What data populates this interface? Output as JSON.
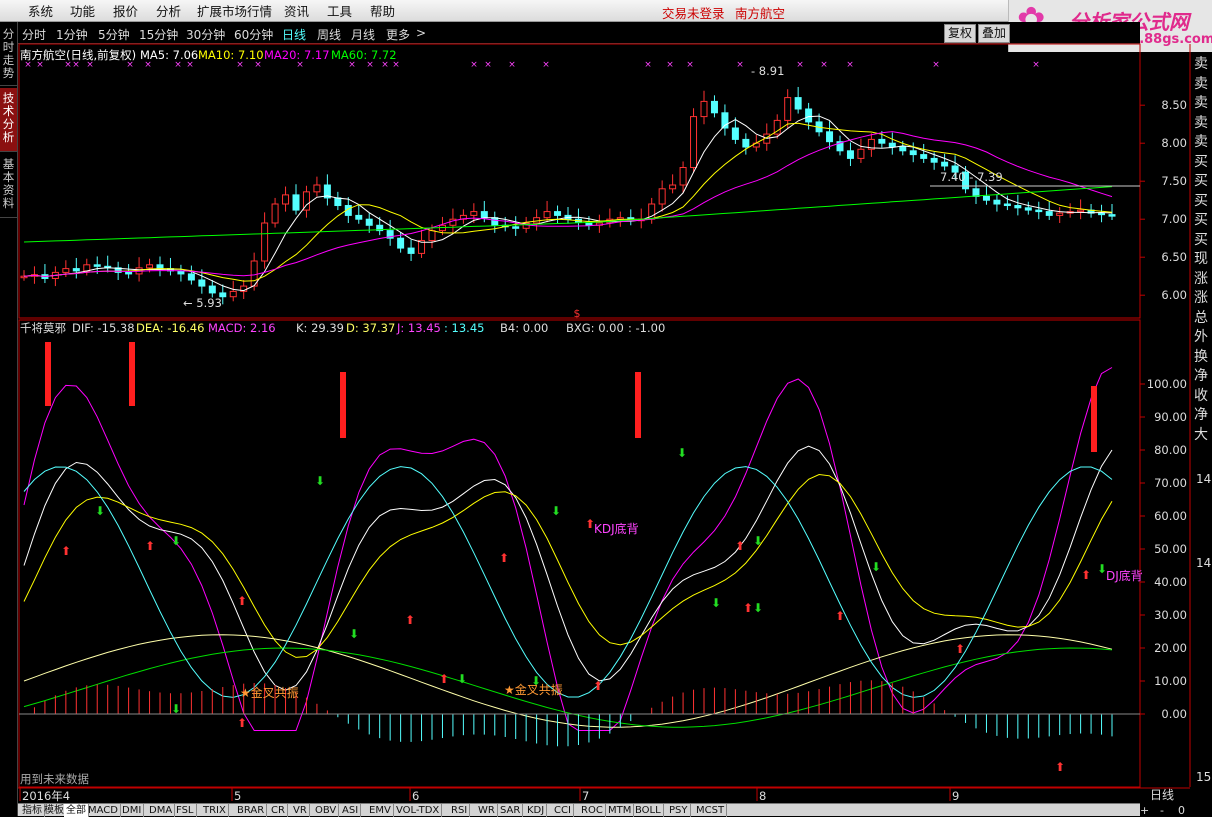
{
  "menu": {
    "items": [
      "系统",
      "功能",
      "报价",
      "分析",
      "扩展市场行情",
      "资讯",
      "工具",
      "帮助"
    ],
    "login_status": "交易未登录",
    "stock_name": "南方航空"
  },
  "logo": {
    "title": "分析家公式网",
    "url": "www.88gs.com"
  },
  "left_tabs": [
    "分时走势",
    "技术分析",
    "基本资料"
  ],
  "period_bar": {
    "items": [
      "分时",
      "1分钟",
      "5分钟",
      "15分钟",
      "30分钟",
      "60分钟",
      "日线",
      "周线",
      "月线",
      "更多"
    ],
    "active": "日线",
    "buttons": [
      "复权",
      "叠加"
    ]
  },
  "right_chars": [
    "卖",
    "卖",
    "卖",
    "卖",
    "卖",
    "买",
    "买",
    "买",
    "买",
    "买",
    "现",
    "涨",
    "涨",
    "总",
    "外",
    "换",
    "净",
    "收",
    "净",
    "大"
  ],
  "right_nums": [
    "14",
    "14",
    "15"
  ],
  "main_header": {
    "title": "南方航空(日线,前复权)",
    "ma5": "MA5: 7.06",
    "ma10": "MA10: 7.10",
    "ma20": "MA20: 7.17",
    "ma60": "MA60: 7.72"
  },
  "indicator_header": {
    "name": "千将莫邪",
    "dif": "DIF: -15.38",
    "dea": "DEA: -16.46",
    "macd": "MACD: 2.16",
    "k": "K: 29.39",
    "d": "D: 37.37",
    "j": "J: 13.45",
    "j2": ": 13.45",
    "b4": "B4: 0.00",
    "bxg": "BXG: 0.00",
    "last": ": -1.00"
  },
  "annotations": {
    "high": "8.91",
    "low": "5.93",
    "mid": "7.40 - 7.39",
    "kdj1": "KDJ底背",
    "kdj2": "DJ底背",
    "gold1": "金叉共振",
    "gold2": "金叉共振",
    "future": "用到未来数据",
    "dollar": "$"
  },
  "colors": {
    "up": "#ff3232",
    "down": "#54ffff",
    "ma5": "#ffffff",
    "ma10": "#ffff00",
    "ma20": "#ff00ff",
    "ma60": "#00ff00",
    "axis": "#c00000",
    "k": "#ffffff",
    "d": "#ffff00",
    "j": "#ff00ff",
    "dif": "#ffffaa",
    "dea": "#00dd00"
  },
  "chart_data": {
    "type": "candlestick",
    "price_axis": {
      "ticks": [
        6.0,
        6.5,
        7.0,
        7.5,
        8.0,
        8.5
      ]
    },
    "indicator_axis": {
      "ticks": [
        0.0,
        10.0,
        20.0,
        30.0,
        40.0,
        50.0,
        60.0,
        70.0,
        80.0,
        90.0,
        100.0
      ]
    },
    "x_labels": [
      "2016年4",
      "5",
      "6",
      "7",
      "8",
      "9"
    ],
    "period_label": "日线",
    "bottom_tabs": [
      "指标",
      "模板",
      "全部",
      "MACD",
      "DMI",
      "DMA",
      "FSL",
      "TRIX",
      "BRAR",
      "CR",
      "VR",
      "OBV",
      "ASI",
      "EMV",
      "VOL-TDX",
      "RSI",
      "WR",
      "SAR",
      "KDJ",
      "CCI",
      "ROC",
      "MTM",
      "BOLL",
      "PSY",
      "MCST"
    ],
    "bottom_controls": [
      "+",
      "-",
      "0"
    ],
    "candles": [
      6.25,
      6.27,
      6.22,
      6.3,
      6.35,
      6.32,
      6.4,
      6.38,
      6.36,
      6.3,
      6.28,
      6.36,
      6.4,
      6.35,
      6.32,
      6.28,
      6.2,
      6.12,
      6.03,
      5.98,
      6.05,
      6.12,
      6.45,
      6.95,
      7.2,
      7.32,
      7.12,
      7.36,
      7.45,
      7.28,
      7.18,
      7.05,
      7.0,
      6.92,
      6.85,
      6.75,
      6.62,
      6.55,
      6.72,
      6.85,
      6.92,
      7.0,
      7.05,
      7.1,
      7.02,
      6.92,
      6.9,
      6.88,
      6.95,
      7.02,
      7.1,
      7.05,
      7.0,
      6.96,
      6.92,
      6.95,
      7.0,
      7.02,
      6.98,
      7.0,
      7.2,
      7.4,
      7.45,
      7.68,
      8.35,
      8.55,
      8.4,
      8.2,
      8.05,
      7.95,
      8.0,
      8.12,
      8.3,
      8.6,
      8.45,
      8.28,
      8.15,
      8.02,
      7.9,
      7.8,
      7.92,
      8.05,
      8.0,
      7.95,
      7.9,
      7.85,
      7.8,
      7.75,
      7.7,
      7.62,
      7.4,
      7.3,
      7.25,
      7.2,
      7.18,
      7.15,
      7.12,
      7.1,
      7.05,
      7.08,
      7.1,
      7.12,
      7.08,
      7.06,
      7.05
    ]
  }
}
